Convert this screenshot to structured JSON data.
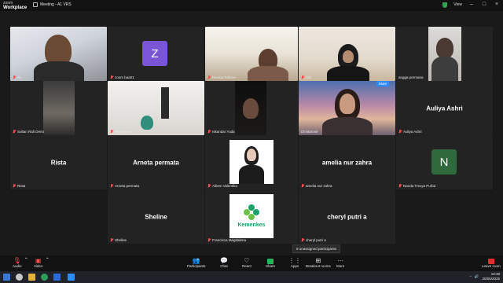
{
  "app": {
    "brand_top": "zoom",
    "brand_bottom": "Workplace",
    "tab_title": "Meeting - A1 VRS"
  },
  "titlebar": {
    "view_label": "View"
  },
  "tiles": {
    "al": "AL",
    "zoom_baa01": "zoom baa01",
    "devina": "Devina Rahma",
    "cm": "CM",
    "angga": "angga permana",
    "sultan": "Sultan Rafi Derio",
    "arja": "Arja Seisa",
    "iskandar": "Iskandar Yuda",
    "dimitarose": "Dimitarose",
    "auliya_big": "Auliya Ashri",
    "auliya": "Auliya Ashri",
    "rista_big": "Rista",
    "rista": "Rista",
    "arneta_big": "Arneta permata",
    "arneta": "Arneta permata",
    "aileen": "Aileen Valentika",
    "amelia_big": "amelia nur zahra",
    "amelia": "amelia nur zahra",
    "nanda": "Nanda Trexya Purba",
    "sheline_big": "Sheline",
    "sheline": "Sheline",
    "francisca": "Francisca Magdalena",
    "cheryl_big": "cheryl putri a",
    "cheryl": "cheryl putri a"
  },
  "avatars": {
    "z": "Z",
    "n": "N"
  },
  "badges": {
    "mute_pill": "Mute"
  },
  "logos": {
    "kemenkes": "Kemenkes"
  },
  "tooltip": "9 unassigned participants",
  "toolbar": {
    "audio": "Audio",
    "video": "Video",
    "participants": "Participants",
    "participants_count": "18",
    "chat": "Chat",
    "react": "React",
    "share": "Share",
    "apps": "Apps",
    "breakout": "Breakout rooms",
    "more": "More",
    "leave": "Leave room"
  },
  "taskbar": {
    "time": "19:38",
    "date": "20/05/2025"
  },
  "colors": {
    "zoom_blue": "#2d8cff",
    "avatar_purple": "#7a55d6",
    "avatar_green": "#2e6a3b",
    "mute_red": "#ff4d4d"
  }
}
